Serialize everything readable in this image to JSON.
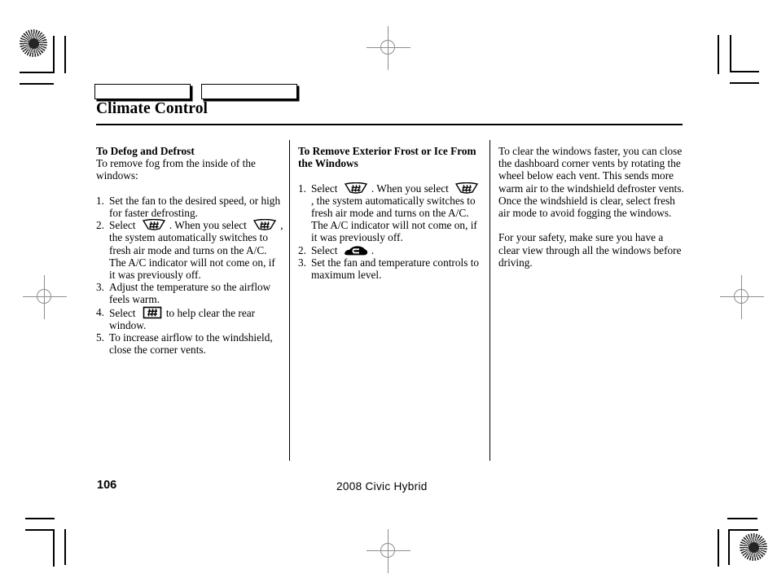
{
  "document": {
    "title": "Climate Control",
    "tabs": [
      {
        "label": ""
      },
      {
        "label": ""
      }
    ],
    "footer": {
      "page_number": "106",
      "book_title": "2008  Civic  Hybrid"
    }
  },
  "columns": [
    {
      "id": "column-defog-defrost",
      "heading": "To Defog and Defrost",
      "intro": "To remove fog from the inside of the windows:",
      "steps": [
        {
          "number": "1.",
          "parts": [
            {
              "type": "text",
              "value": "Set the fan to the desired speed, or high for faster defrosting."
            }
          ]
        },
        {
          "number": "2.",
          "parts": [
            {
              "type": "text",
              "value": "Select"
            },
            {
              "type": "icon",
              "value": "front-defroster-icon"
            },
            {
              "type": "text",
              "value": ". When you select"
            },
            {
              "type": "icon",
              "value": "front-defroster-icon"
            },
            {
              "type": "text",
              "value": ", the system automatically switches to fresh air mode and turns on the A/C. The A/C indicator will not come on, if it was previously off."
            }
          ]
        },
        {
          "number": "3.",
          "parts": [
            {
              "type": "text",
              "value": "Adjust the temperature so the airflow feels warm."
            }
          ]
        },
        {
          "number": "4.",
          "parts": [
            {
              "type": "text",
              "value": "Select"
            },
            {
              "type": "icon",
              "value": "rear-defroster-icon"
            },
            {
              "type": "text",
              "value": "to help clear the rear window."
            }
          ]
        },
        {
          "number": "5.",
          "parts": [
            {
              "type": "text",
              "value": "To increase airflow to the windshield, close the corner vents."
            }
          ]
        }
      ]
    },
    {
      "id": "column-remove-frost",
      "heading": "To Remove Exterior Frost or Ice From the Windows",
      "steps": [
        {
          "number": "1.",
          "parts": [
            {
              "type": "text",
              "value": "Select"
            },
            {
              "type": "icon",
              "value": "front-defroster-icon"
            },
            {
              "type": "text",
              "value": ". When you select"
            },
            {
              "type": "icon",
              "value": "front-defroster-icon"
            },
            {
              "type": "text",
              "value": ", the system automatically switches to fresh air mode and turns on the A/C. The A/C indicator will not come on, if it was previously off."
            }
          ]
        },
        {
          "number": "2.",
          "parts": [
            {
              "type": "text",
              "value": "Select"
            },
            {
              "type": "icon",
              "value": "fresh-air-mode-icon"
            },
            {
              "type": "text",
              "value": "."
            }
          ]
        },
        {
          "number": "3.",
          "parts": [
            {
              "type": "text",
              "value": "Set the fan and temperature controls to maximum level."
            }
          ]
        }
      ]
    },
    {
      "id": "column-notes",
      "paragraphs": [
        "To clear the windows faster, you can close the dashboard corner vents by rotating the wheel below each vent. This sends more warm air to the windshield defroster vents. Once the windshield is clear, select fresh air mode to avoid fogging the windows.",
        "For your safety, make sure you have a clear view through all the windows before driving."
      ]
    }
  ],
  "print_marks": {
    "registration_star": "registration-star-mark",
    "registration_cross": "registration-crosshair-mark",
    "crop": "crop-mark"
  }
}
